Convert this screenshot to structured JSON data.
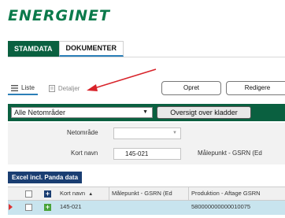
{
  "app": {
    "logo": "ENERGINET"
  },
  "tabs": [
    {
      "label": "STAMDATA",
      "active": true
    },
    {
      "label": "DOKUMENTER",
      "active": false
    }
  ],
  "view": {
    "list_label": "Liste",
    "details_label": "Detaljer"
  },
  "actions": {
    "create": "Opret",
    "edit": "Redigere"
  },
  "filter": {
    "area_select": "Alle Netområder",
    "overview_button": "Oversigt over kladder"
  },
  "form": {
    "netomraade_label": "Netområde",
    "netomraade_value": "",
    "kortnavn_label": "Kort navn",
    "kortnavn_value": "145-021",
    "maalepunkt_label": "Målepunkt - GSRN (Ed"
  },
  "export": {
    "excel_button": "Excel incl. Panda data"
  },
  "grid": {
    "columns": [
      "Kort navn",
      "Målepunkt - GSRN (Ed",
      "Produktion - Aftage GSRN"
    ],
    "sort_indicator": "▲",
    "rows": [
      {
        "kortnavn": "145-021",
        "maalepunkt": "",
        "produktion": "580000000000010075"
      }
    ]
  },
  "colors": {
    "brand_green": "#0a6040",
    "logo_green": "#0b7a4b",
    "excel_blue": "#1a3e72",
    "row_selected": "#c8e4ee"
  }
}
